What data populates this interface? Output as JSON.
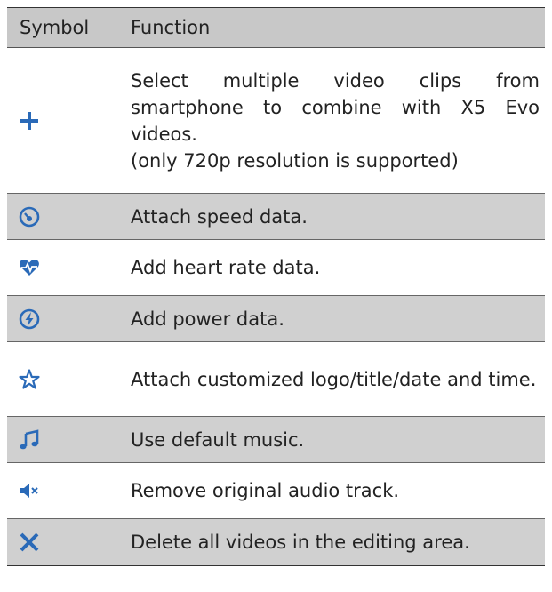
{
  "header": {
    "symbol": "Symbol",
    "function": "Function"
  },
  "rows": [
    {
      "icon": "plus-icon",
      "lines": [
        "Select multiple video clips from smartphone to combine with X5 Evo videos.",
        "(only 720p resolution is supported)"
      ]
    },
    {
      "icon": "speedometer-icon",
      "lines": [
        "Attach speed data."
      ]
    },
    {
      "icon": "heart-rate-icon",
      "lines": [
        "Add heart rate data."
      ]
    },
    {
      "icon": "power-bolt-icon",
      "lines": [
        "Add power data."
      ]
    },
    {
      "icon": "star-icon",
      "lines": [
        "Attach customized logo/title/date and time."
      ]
    },
    {
      "icon": "music-note-icon",
      "lines": [
        "Use default music."
      ]
    },
    {
      "icon": "mute-speaker-icon",
      "lines": [
        "Remove original audio track."
      ]
    },
    {
      "icon": "delete-x-icon",
      "lines": [
        "Delete all videos in the editing area."
      ]
    }
  ],
  "colors": {
    "icon_blue": "#2a6ab8",
    "header_bg": "#c8c8c8",
    "shaded_row": "#d0d0d0"
  }
}
